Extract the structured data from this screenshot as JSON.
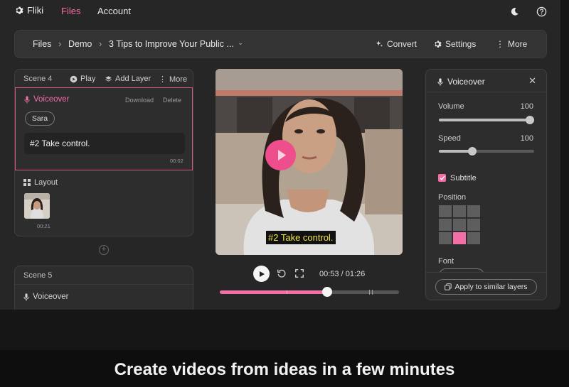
{
  "nav": {
    "brand": "Fliki",
    "files": "Files",
    "account": "Account"
  },
  "colors": {
    "accent": "#f26ea6",
    "caption_text": "#f3e64b"
  },
  "breadcrumb": {
    "root": "Files",
    "folder": "Demo",
    "file": "3 Tips to Improve Your Public ..."
  },
  "toolbar": {
    "convert": "Convert",
    "settings": "Settings",
    "more": "More"
  },
  "scene4": {
    "title": "Scene 4",
    "play": "Play",
    "add_layer": "Add Layer",
    "more": "More",
    "voiceover": {
      "label": "Voiceover",
      "download": "Download",
      "delete": "Delete",
      "voice": "Sara",
      "text": "#2 Take control.",
      "duration": "00:02"
    },
    "layout": {
      "label": "Layout",
      "thumb_duration": "00:21"
    }
  },
  "scene5": {
    "title": "Scene 5",
    "voiceover_label": "Voiceover"
  },
  "player": {
    "caption": "#2 Take control.",
    "time": "00:53 / 01:26",
    "progress": 0.6
  },
  "panel": {
    "title": "Voiceover",
    "volume_label": "Volume",
    "volume_value": "100",
    "volume_level": 1.0,
    "speed_label": "Speed",
    "speed_value": "100",
    "speed_level": 0.35,
    "subtitle_label": "Subtitle",
    "subtitle_checked": true,
    "position_label": "Position",
    "position_selected": 7,
    "font_label": "Font",
    "apply_button": "Apply to similar layers"
  },
  "tagline": "Create videos from ideas in a few minutes"
}
